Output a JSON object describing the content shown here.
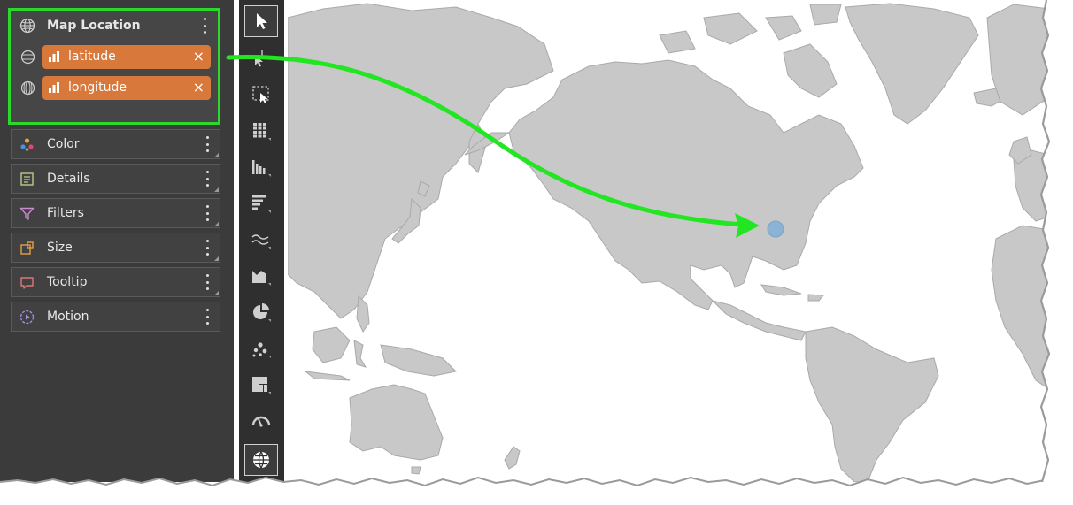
{
  "shelves": {
    "map_location": {
      "title": "Map Location",
      "fields": [
        {
          "label": "latitude",
          "type_icon": "latitude-globe-icon",
          "remove": "×"
        },
        {
          "label": "longitude",
          "type_icon": "longitude-globe-icon",
          "remove": "×"
        }
      ]
    },
    "items": [
      {
        "label": "Color",
        "icon": "color-dots-icon"
      },
      {
        "label": "Details",
        "icon": "details-icon"
      },
      {
        "label": "Filters",
        "icon": "filter-icon"
      },
      {
        "label": "Size",
        "icon": "size-icon"
      },
      {
        "label": "Tooltip",
        "icon": "tooltip-icon"
      },
      {
        "label": "Motion",
        "icon": "motion-icon"
      }
    ]
  },
  "toolbar": {
    "tools": [
      "pointer-icon",
      "fill-select-icon",
      "marquee-select-icon",
      "table-icon",
      "column-chart-icon",
      "bar-chart-icon",
      "line-chart-icon",
      "area-chart-icon",
      "pie-chart-icon",
      "scatter-icon",
      "treemap-icon",
      "gauge-icon",
      "map-globe-icon"
    ],
    "active": [
      "pointer-icon",
      "map-globe-icon"
    ]
  },
  "map": {
    "land_color": "#c8c8c8",
    "coast_color": "#a9a9a9",
    "point_color": "#8bb3d6",
    "point": "Single data point in central United States"
  },
  "annotation": {
    "arrow_color": "#21e621",
    "highlight_color": "#2bd82b"
  },
  "colors": {
    "pill": "#d9783b",
    "panel": "#3b3b3b",
    "toolbar": "#2f2f2f"
  }
}
